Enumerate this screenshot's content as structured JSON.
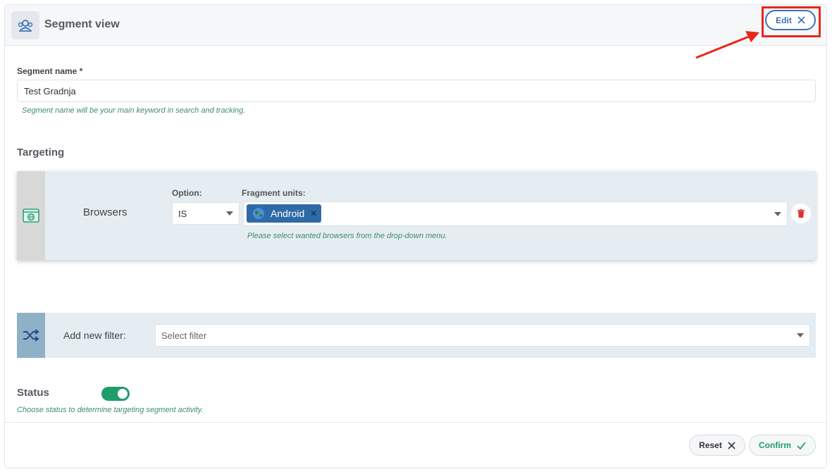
{
  "header": {
    "title": "Segment view",
    "icon": "segment-users-icon"
  },
  "edit_button": {
    "label": "Edit"
  },
  "segment_name": {
    "label": "Segment name *",
    "value": "Test Gradnja",
    "hint": "Segment name will be your main keyword in search and tracking."
  },
  "targeting": {
    "title": "Targeting",
    "rule": {
      "name": "Browsers",
      "option_label": "Option:",
      "option_value": "IS",
      "fragment_label": "Fragment units:",
      "fragment_chips": [
        "Android"
      ],
      "hint": "Please select wanted browsers from the drop-down menu."
    }
  },
  "add_filter": {
    "label": "Add new filter:",
    "placeholder": "Select filter"
  },
  "status": {
    "label": "Status",
    "enabled": true,
    "hint": "Choose status to determine targeting segment activity."
  },
  "footer": {
    "reset_label": "Reset",
    "confirm_label": "Confirm"
  },
  "colors": {
    "accent_blue": "#3b73b5",
    "highlight_red": "#e8261b",
    "status_green": "#1f9d6b",
    "hint_teal": "#3e8a7a"
  }
}
